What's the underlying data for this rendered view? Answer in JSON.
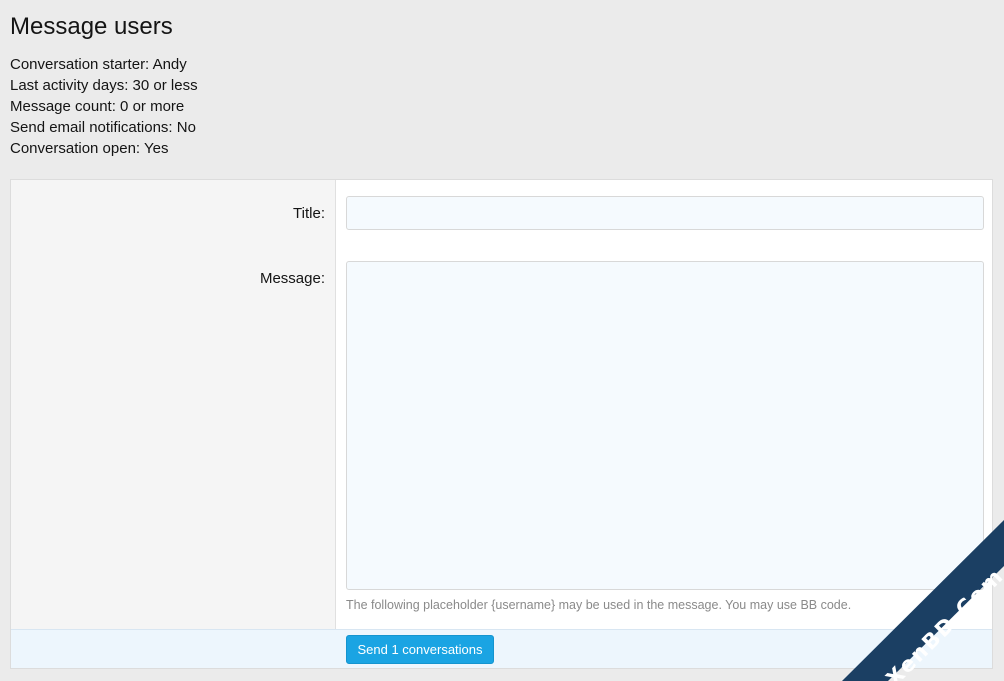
{
  "page": {
    "title": "Message users"
  },
  "criteria": [
    "Conversation starter: Andy",
    "Last activity days: 30 or less",
    "Message count: 0 or more",
    "Send email notifications: No",
    "Conversation open: Yes"
  ],
  "form": {
    "title_label": "Title:",
    "title_value": "",
    "message_label": "Message:",
    "message_value": "",
    "hint": "The following placeholder {username} may be used in the message. You may use BB code.",
    "submit_label": "Send 1 conversations"
  },
  "watermark": {
    "text": "XenBD.Com"
  },
  "colors": {
    "page_background": "#ebebeb",
    "accent": "#1aa4e3",
    "input_background": "#f5fafe",
    "footer_background": "#edf6fd",
    "watermark_band": "#1b3f63"
  }
}
